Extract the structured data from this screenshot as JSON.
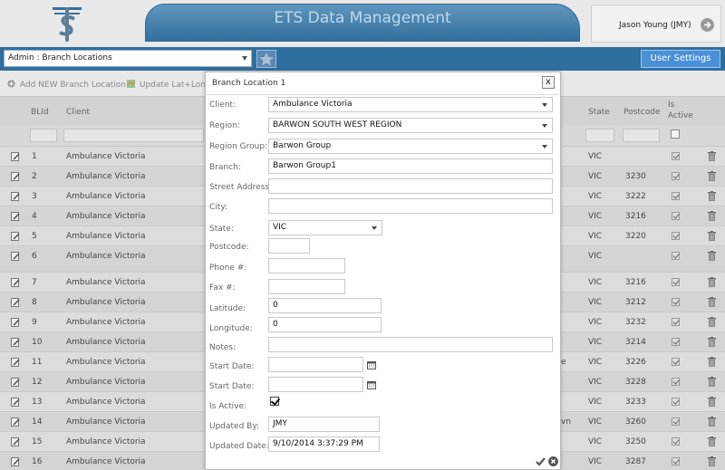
{
  "header": {
    "app_title": "ETS Data Management",
    "user_name": "Jason Young (JMY)"
  },
  "nav": {
    "admin_select_value": "Admin : Branch Locations",
    "user_settings_label": "User Settings"
  },
  "toolbar": {
    "add_new_label": "Add NEW Branch Location",
    "update_latlong_label": "Update Lat+Long"
  },
  "grid": {
    "columns": {
      "blid": "BLId",
      "client": "Client",
      "state": "State",
      "postcode": "Postcode",
      "is_active": "Is Active"
    },
    "rows": [
      {
        "blid": "1",
        "client": "Ambulance Victoria",
        "extra": "",
        "state": "VIC",
        "postcode": ""
      },
      {
        "blid": "2",
        "client": "Ambulance Victoria",
        "extra": "",
        "state": "VIC",
        "postcode": "3230"
      },
      {
        "blid": "3",
        "client": "Ambulance Victoria",
        "extra": "",
        "state": "VIC",
        "postcode": "3222"
      },
      {
        "blid": "4",
        "client": "Ambulance Victoria",
        "extra": "",
        "state": "VIC",
        "postcode": "3216"
      },
      {
        "blid": "5",
        "client": "Ambulance Victoria",
        "extra": "",
        "state": "VIC",
        "postcode": "3220"
      },
      {
        "blid": "6",
        "client": "Ambulance Victoria",
        "extra": "",
        "state": "VIC",
        "postcode": ""
      },
      {
        "blid": "7",
        "client": "Ambulance Victoria",
        "extra": "",
        "state": "VIC",
        "postcode": "3216"
      },
      {
        "blid": "8",
        "client": "Ambulance Victoria",
        "extra": "",
        "state": "VIC",
        "postcode": "3212"
      },
      {
        "blid": "9",
        "client": "Ambulance Victoria",
        "extra": "",
        "state": "VIC",
        "postcode": "3232"
      },
      {
        "blid": "10",
        "client": "Ambulance Victoria",
        "extra": "",
        "state": "VIC",
        "postcode": "3214"
      },
      {
        "blid": "11",
        "client": "Ambulance Victoria",
        "extra": "e",
        "state": "VIC",
        "postcode": "3226"
      },
      {
        "blid": "12",
        "client": "Ambulance Victoria",
        "extra": "",
        "state": "VIC",
        "postcode": "3228"
      },
      {
        "blid": "13",
        "client": "Ambulance Victoria",
        "extra": "",
        "state": "VIC",
        "postcode": "3233"
      },
      {
        "blid": "14",
        "client": "Ambulance Victoria",
        "extra": "vn",
        "state": "VIC",
        "postcode": "3260"
      },
      {
        "blid": "15",
        "client": "Ambulance Victoria",
        "extra": "",
        "state": "VIC",
        "postcode": "3250"
      },
      {
        "blid": "16",
        "client": "Ambulance Victoria",
        "extra": "",
        "state": "VIC",
        "postcode": "3287"
      }
    ]
  },
  "modal": {
    "title": "Branch Location 1",
    "close_label": "x",
    "labels": {
      "client": "Client:",
      "region": "Region:",
      "region_group": "Region Group:",
      "branch": "Branch:",
      "street_address": "Street Address:",
      "city": "City:",
      "state": "State:",
      "postcode": "Postcode:",
      "phone": "Phone #:",
      "fax": "Fax #:",
      "latitude": "Latitude:",
      "longitude": "Longitude:",
      "notes": "Notes:",
      "start_date_1": "Start Date:",
      "start_date_2": "Start Date:",
      "is_active": "Is Active:",
      "updated_by": "Updated By:",
      "updated_date": "Updated Date:"
    },
    "values": {
      "client": "Ambulance Victoria",
      "region": "BARWON SOUTH WEST REGION",
      "region_group": "Barwon Group",
      "branch": "Barwon Group1",
      "street_address": "",
      "city": "",
      "state": "VIC",
      "postcode": "",
      "phone": "",
      "fax": "",
      "latitude": "0",
      "longitude": "0",
      "notes": "",
      "start_date_1": "",
      "start_date_2": "",
      "is_active": true,
      "updated_by": "JMY",
      "updated_date": "9/10/2014 3:37:29 PM"
    }
  },
  "colors": {
    "nav_blue": "#2f6fa0",
    "banner_blue": "#4a86b3",
    "button_blue": "#4a90d6"
  }
}
